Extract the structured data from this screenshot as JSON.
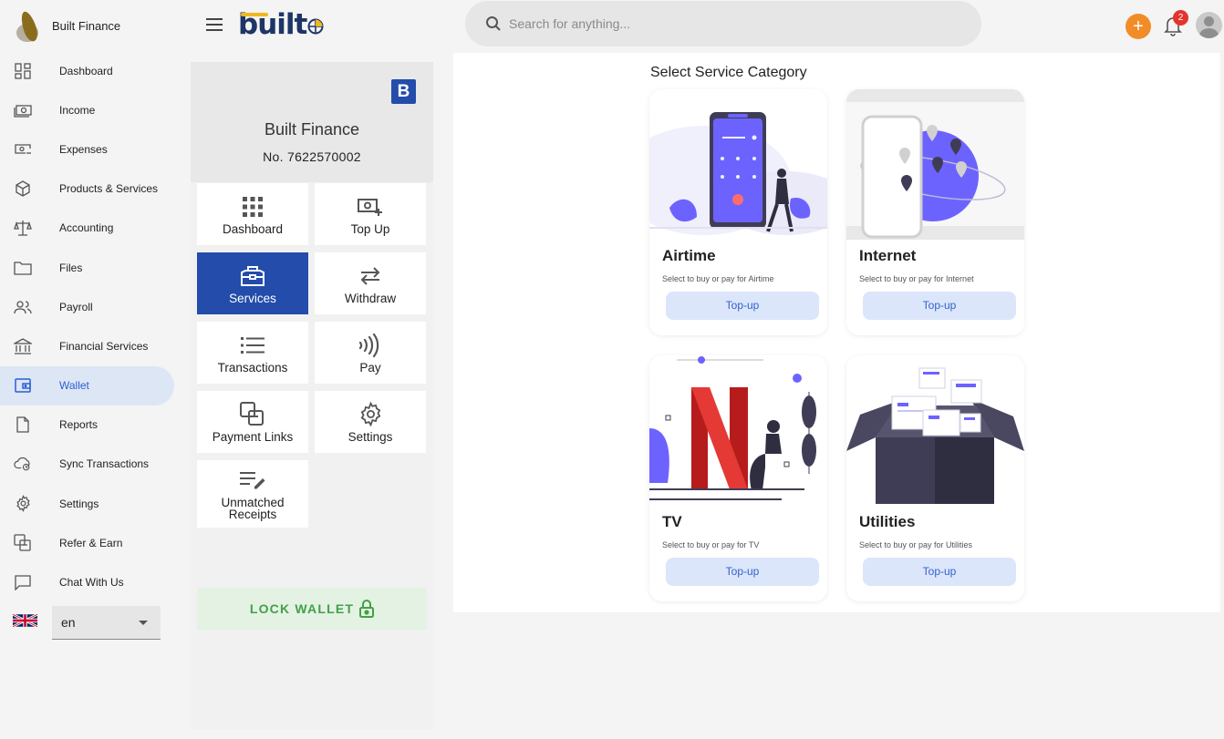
{
  "app": {
    "brand_name": "Built Finance",
    "logo_text": "built"
  },
  "sidebar": {
    "items": [
      {
        "label": "Dashboard",
        "icon": "dashboard-icon"
      },
      {
        "label": "Income",
        "icon": "income-icon"
      },
      {
        "label": "Expenses",
        "icon": "expenses-icon"
      },
      {
        "label": "Products & Services",
        "icon": "box-icon"
      },
      {
        "label": "Accounting",
        "icon": "scale-icon"
      },
      {
        "label": "Files",
        "icon": "folder-icon"
      },
      {
        "label": "Payroll",
        "icon": "people-icon"
      },
      {
        "label": "Financial Services",
        "icon": "bank-icon"
      },
      {
        "label": "Wallet",
        "icon": "wallet-icon",
        "active": true
      },
      {
        "label": "Reports",
        "icon": "document-icon"
      },
      {
        "label": "Sync Transactions",
        "icon": "cloud-sync-icon"
      },
      {
        "label": "Settings",
        "icon": "gear-icon"
      },
      {
        "label": "Refer & Earn",
        "icon": "refer-icon"
      },
      {
        "label": "Chat With Us",
        "icon": "chat-icon"
      }
    ],
    "language": {
      "value": "en",
      "flag": "uk-flag-icon"
    }
  },
  "header": {
    "search_placeholder": "Search for anything...",
    "notification_count": "2",
    "add_label": "+"
  },
  "wallet": {
    "account_badge": "B",
    "account_name": "Built Finance",
    "account_number": "No. 7622570002",
    "tiles": [
      {
        "label": "Dashboard",
        "icon": "grid-icon"
      },
      {
        "label": "Top Up",
        "icon": "topup-icon"
      },
      {
        "label": "Services",
        "icon": "toolbox-icon",
        "active": true
      },
      {
        "label": "Withdraw",
        "icon": "transfer-icon"
      },
      {
        "label": "Transactions",
        "icon": "list-icon"
      },
      {
        "label": "Pay",
        "icon": "contactless-icon"
      },
      {
        "label": "Payment Links",
        "icon": "payment-links-icon"
      },
      {
        "label": "Settings",
        "icon": "gear-icon"
      },
      {
        "label": "Unmatched Receipts",
        "icon": "edit-list-icon"
      }
    ],
    "lock_label": "LOCK WALLET"
  },
  "services": {
    "title": "Select Service Category",
    "categories": [
      {
        "title": "Airtime",
        "description": "Select to buy or pay for Airtime",
        "button": "Top-up"
      },
      {
        "title": "Internet",
        "description": "Select to buy or pay for Internet",
        "button": "Top-up"
      },
      {
        "title": "TV",
        "description": "Select to buy or pay for TV",
        "button": "Top-up"
      },
      {
        "title": "Utilities",
        "description": "Select to buy or pay for Utilities",
        "button": "Top-up"
      }
    ]
  },
  "colors": {
    "primary": "#234cab",
    "active_nav_bg": "#dde6f4",
    "accent_orange": "#f28c28",
    "illustration_purple": "#6c63ff",
    "lock_green": "#43a047",
    "button_bg": "#dbe6fb"
  }
}
